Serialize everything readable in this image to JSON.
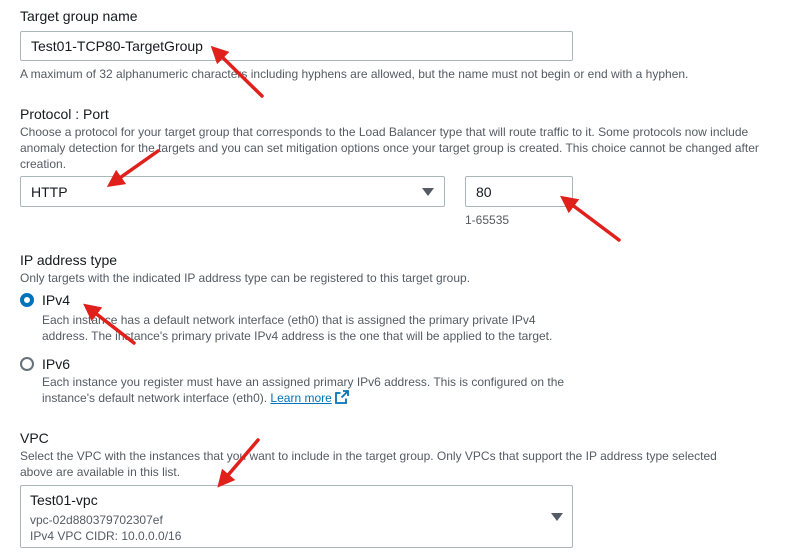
{
  "target_group_name": {
    "label": "Target group name",
    "value": "Test01-TCP80-TargetGroup",
    "hint": "A maximum of 32 alphanumeric characters including hyphens are allowed, but the name must not begin or end with a hyphen."
  },
  "protocol_port": {
    "label": "Protocol : Port",
    "description": "Choose a protocol for your target group that corresponds to the Load Balancer type that will route traffic to it. Some protocols now include anomaly detection for the targets and you can set mitigation options once your target group is created. This choice cannot be changed after creation.",
    "protocol_value": "HTTP",
    "port_value": "80",
    "port_hint": "1-65535"
  },
  "ip_address_type": {
    "label": "IP address type",
    "description": "Only targets with the indicated IP address type can be registered to this target group.",
    "options": [
      {
        "label": "IPv4",
        "selected": true,
        "description": "Each instance has a default network interface (eth0) that is assigned the primary private IPv4 address. The instance's primary private IPv4 address is the one that will be applied to the target."
      },
      {
        "label": "IPv6",
        "selected": false,
        "description": "Each instance you register must have an assigned primary IPv6 address. This is configured on the instance's default network interface (eth0).",
        "link": "Learn more",
        "link_icon": "external-link-icon"
      }
    ]
  },
  "vpc": {
    "label": "VPC",
    "description": "Select the VPC with the instances that you want to include in the target group. Only VPCs that support the IP address type selected above are available in this list.",
    "selected_name": "Test01-vpc",
    "selected_id": "vpc-02d880379702307ef",
    "selected_cidr": "IPv4 VPC CIDR: 10.0.0.0/16"
  },
  "annotations": {
    "arrow_color": "#e0201b",
    "arrow_icon": "red-arrow-icon"
  },
  "colors": {
    "accent": "#0073bb",
    "border": "#aab7b8",
    "text": "#16191f",
    "secondary_text": "#545b64"
  }
}
